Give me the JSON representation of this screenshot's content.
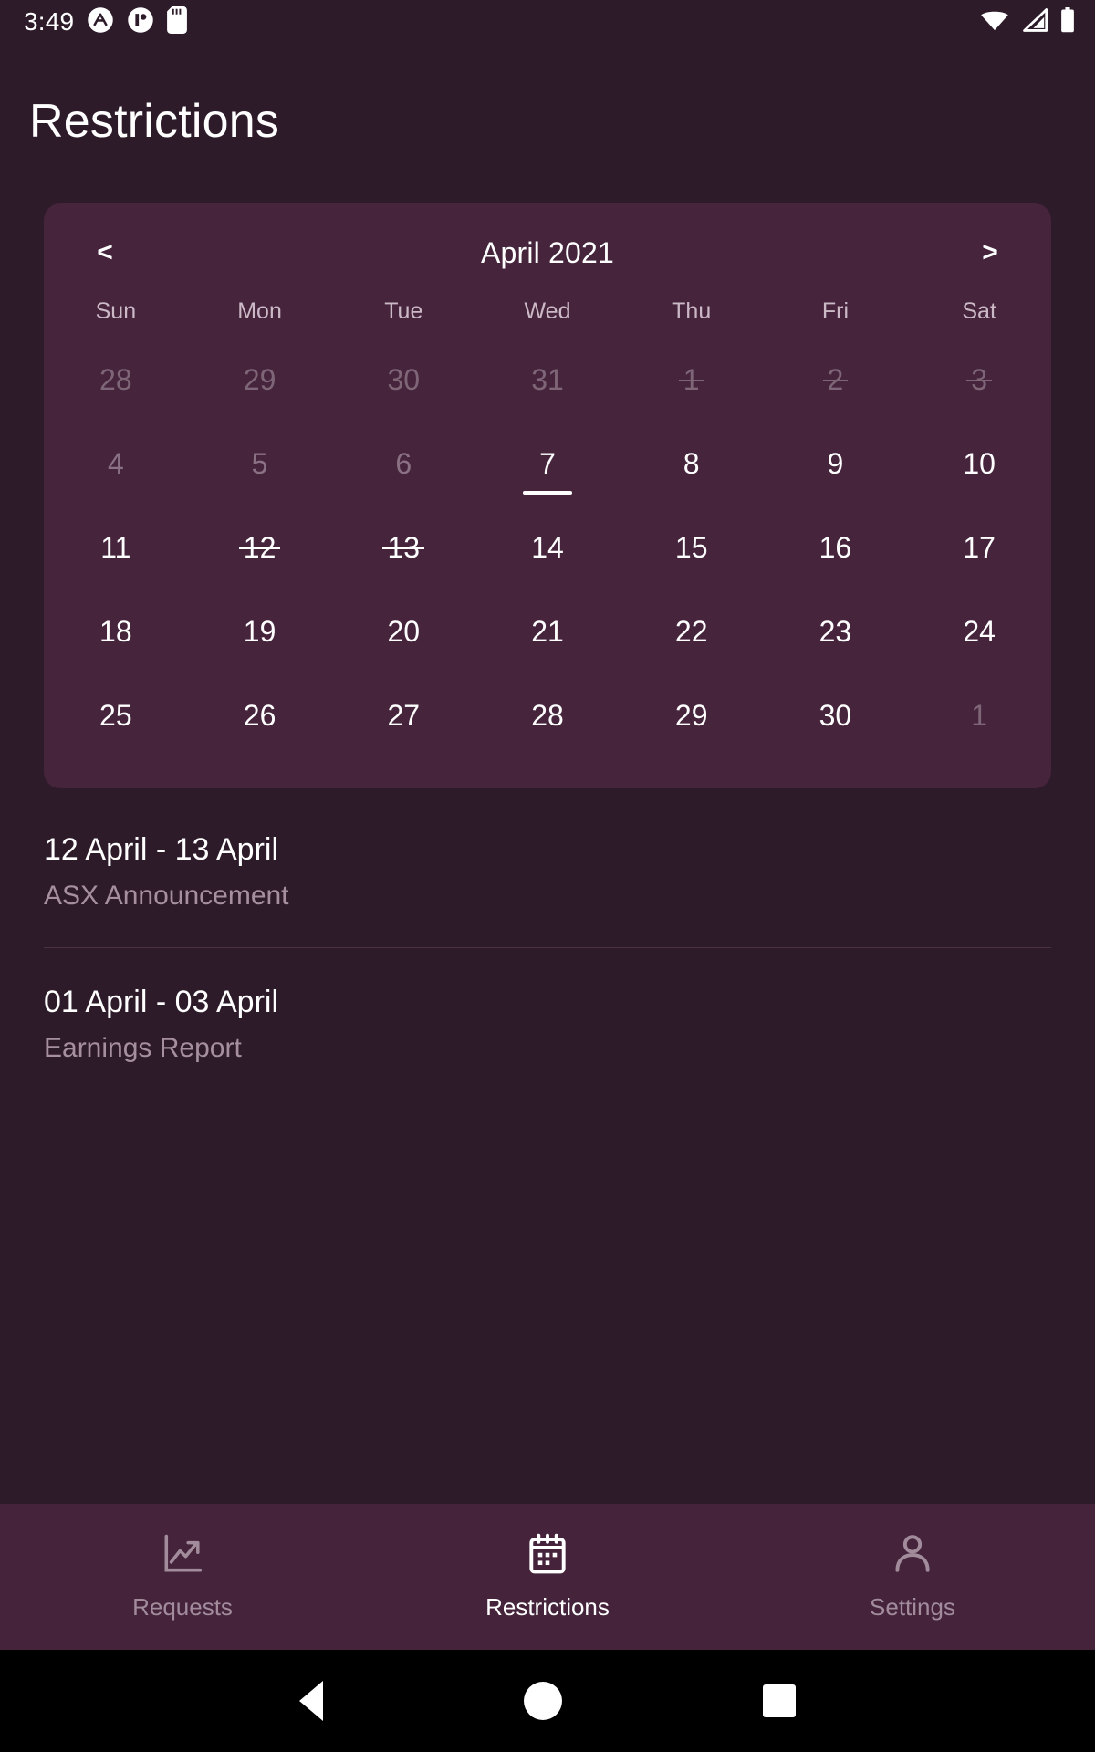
{
  "statusbar": {
    "time": "3:49",
    "left_icons": [
      "appa-circle-icon",
      "appb-circle-icon",
      "sd-card-icon"
    ],
    "right_icons": [
      "wifi-icon",
      "cell-signal-icon",
      "battery-icon"
    ]
  },
  "header": {
    "title": "Restrictions"
  },
  "calendar": {
    "month_label": "April 2021",
    "prev_label": "<",
    "next_label": ">",
    "weekdays": [
      "Sun",
      "Mon",
      "Tue",
      "Wed",
      "Thu",
      "Fri",
      "Sat"
    ],
    "weeks": [
      [
        {
          "day": "28",
          "state": "outside"
        },
        {
          "day": "29",
          "state": "outside"
        },
        {
          "day": "30",
          "state": "outside"
        },
        {
          "day": "31",
          "state": "outside"
        },
        {
          "day": "1",
          "state": "outside",
          "restricted": true
        },
        {
          "day": "2",
          "state": "outside",
          "restricted": true
        },
        {
          "day": "3",
          "state": "outside",
          "restricted": true
        }
      ],
      [
        {
          "day": "4",
          "state": "past"
        },
        {
          "day": "5",
          "state": "past"
        },
        {
          "day": "6",
          "state": "past"
        },
        {
          "day": "7",
          "state": "selected"
        },
        {
          "day": "8",
          "state": "normal"
        },
        {
          "day": "9",
          "state": "normal"
        },
        {
          "day": "10",
          "state": "normal"
        }
      ],
      [
        {
          "day": "11",
          "state": "normal"
        },
        {
          "day": "12",
          "state": "normal",
          "restricted": true
        },
        {
          "day": "13",
          "state": "normal",
          "restricted": true
        },
        {
          "day": "14",
          "state": "normal"
        },
        {
          "day": "15",
          "state": "normal"
        },
        {
          "day": "16",
          "state": "normal"
        },
        {
          "day": "17",
          "state": "normal"
        }
      ],
      [
        {
          "day": "18",
          "state": "normal"
        },
        {
          "day": "19",
          "state": "normal"
        },
        {
          "day": "20",
          "state": "normal"
        },
        {
          "day": "21",
          "state": "normal"
        },
        {
          "day": "22",
          "state": "normal"
        },
        {
          "day": "23",
          "state": "normal"
        },
        {
          "day": "24",
          "state": "normal"
        }
      ],
      [
        {
          "day": "25",
          "state": "normal"
        },
        {
          "day": "26",
          "state": "normal"
        },
        {
          "day": "27",
          "state": "normal"
        },
        {
          "day": "28",
          "state": "normal"
        },
        {
          "day": "29",
          "state": "normal"
        },
        {
          "day": "30",
          "state": "normal"
        },
        {
          "day": "1",
          "state": "outside"
        }
      ]
    ]
  },
  "restrictions": [
    {
      "range": "12 April - 13 April",
      "type": "ASX Announcement"
    },
    {
      "range": "01 April - 03 April",
      "type": "Earnings Report"
    }
  ],
  "bottomnav": {
    "items": [
      {
        "label": "Requests",
        "icon": "trending-chart-icon",
        "active": false
      },
      {
        "label": "Restrictions",
        "icon": "calendar-icon",
        "active": true
      },
      {
        "label": "Settings",
        "icon": "person-icon",
        "active": false
      }
    ]
  },
  "systembar": {
    "back": "back-triangle-icon",
    "home": "home-circle-icon",
    "recents": "recents-square-icon"
  },
  "colors": {
    "background": "#2E1B2A",
    "card": "#45243C",
    "navbar": "#44233B",
    "text_primary": "#FFFFFF",
    "text_muted": "#A690A0",
    "text_dim": "#7E6677"
  }
}
